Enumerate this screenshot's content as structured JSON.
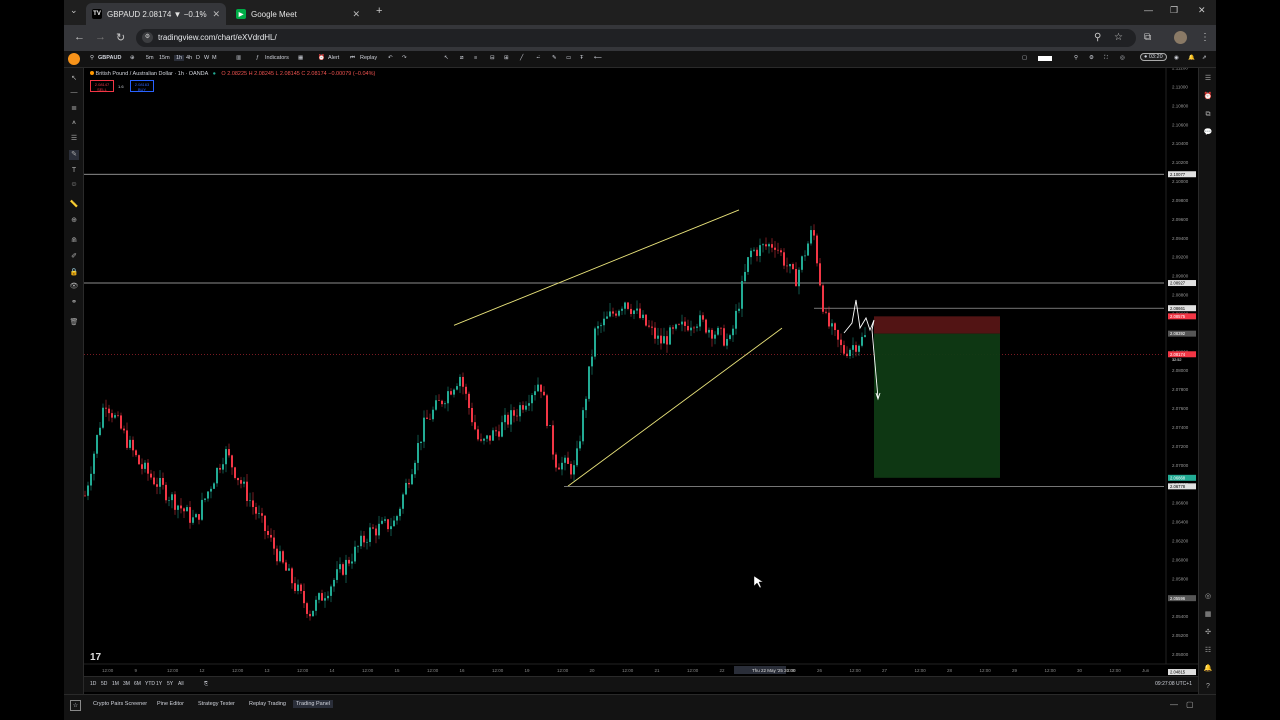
{
  "browser": {
    "tabs": [
      {
        "label": "GBPAUD 2.08174 ▼ −0.1%",
        "active": true
      },
      {
        "label": "Google Meet",
        "active": false
      }
    ],
    "url": "tradingview.com/chart/eXVdrdHL/"
  },
  "toolbar": {
    "symbol": "GBPAUD",
    "intervals": [
      "5m",
      "15m",
      "1h",
      "4h",
      "D",
      "W",
      "M"
    ],
    "indicators_label": "Indicators",
    "alert_label": "Alert",
    "replay_label": "Replay",
    "time_display": "03:20"
  },
  "legend": {
    "title": "British Pound / Australian Dollar · 1h · OANDA",
    "ohlc": "O 2.08225 H 2.08245 L 2.08145 C 2.08174 −0.00079 (−0.04%)",
    "sell_price": "2.08147",
    "sell_label": "SELL",
    "spread": "1.6",
    "buy_price": "2.08163",
    "buy_label": "BUY"
  },
  "chart_data": {
    "type": "candlestick",
    "price_labels": [
      "2.11200",
      "2.11000",
      "2.10800",
      "2.10600",
      "2.10400",
      "2.10200",
      "2.10000",
      "2.09800",
      "2.09600",
      "2.09400",
      "2.09200",
      "2.09000",
      "2.08800",
      "2.08600",
      "2.08400",
      "2.08200",
      "2.08000",
      "2.07800",
      "2.07600",
      "2.07400",
      "2.07200",
      "2.07000",
      "2.06800",
      "2.06600",
      "2.06400",
      "2.06200",
      "2.06000",
      "2.05800",
      "2.05600",
      "2.05400",
      "2.05200",
      "2.05000"
    ],
    "ylim": [
      2.049,
      2.112
    ],
    "time_labels": [
      "12:00",
      "9",
      "12:00",
      "12",
      "12:00",
      "13",
      "12:00",
      "14",
      "12:00",
      "15",
      "12:00",
      "16",
      "12:00",
      "19",
      "12:00",
      "20",
      "12:00",
      "21",
      "12:00",
      "22",
      "Thu 22 May '25  20:00",
      "12:00",
      "26",
      "12:00",
      "27",
      "12:00",
      "28",
      "12:00",
      "29",
      "12:00",
      "30",
      "12:00",
      "Jun"
    ],
    "horizontal_lines": [
      2.10077,
      2.08927,
      2.08661,
      2.06778
    ],
    "axis_badges": [
      {
        "price": "2.10077",
        "color": "#e0e0e0"
      },
      {
        "price": "2.08927",
        "color": "#e0e0e0"
      },
      {
        "price": "2.08661",
        "color": "#e0e0e0"
      },
      {
        "price": "2.08575",
        "color": "#f23645"
      },
      {
        "price": "2.08392",
        "color": "#555555"
      },
      {
        "price": "2.08174",
        "color": "#f23645"
      },
      {
        "price": "2.06868",
        "color": "#22ab94"
      },
      {
        "price": "2.06778",
        "color": "#e0e0e0"
      },
      {
        "price": "2.05596",
        "color": "#555555"
      },
      {
        "price": "2.04815",
        "color": "#e0e0e0"
      }
    ],
    "countdown": "32:52",
    "timezone": "09:27:08 UTC+1",
    "ranges": [
      "1D",
      "5D",
      "1M",
      "3M",
      "6M",
      "YTD",
      "1Y",
      "5Y",
      "All"
    ],
    "short_position": {
      "entry": 2.08392,
      "stop": 2.08575,
      "target": 2.06868
    },
    "colors": {
      "up": "#22ab94",
      "down": "#f23645",
      "trendline": "#e8e27a",
      "hline": "#bbbbbb"
    }
  },
  "bottom_tabs": [
    "Crypto Pairs Screener",
    "Pine Editor",
    "Strategy Tester",
    "Replay Trading",
    "Trading Panel"
  ],
  "active_bottom_tab": "Trading Panel"
}
